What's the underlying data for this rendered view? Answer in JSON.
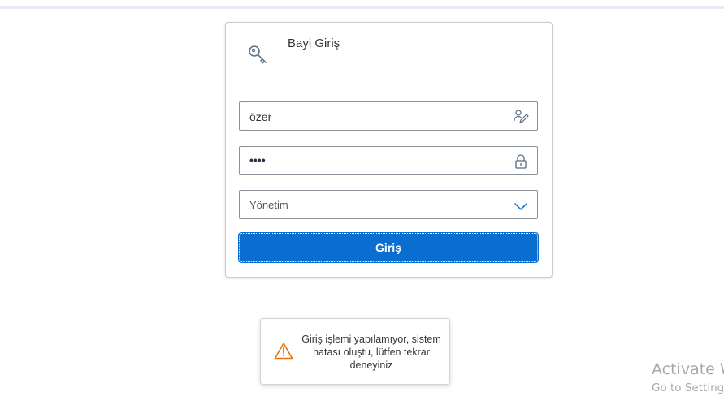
{
  "login": {
    "title": "Bayi Giriş",
    "username_value": "özer",
    "password_mask": "••••",
    "dealer_select_value": "Yönetim",
    "submit_label": "Giriş"
  },
  "toast": {
    "message": "Giriş işlemi yapılamıyor, sistem hatası oluştu, lütfen tekrar deneyiniz"
  },
  "watermark": {
    "line1": "Activate W",
    "line2": "Go to Setting"
  },
  "colors": {
    "accent": "#0a6ed1",
    "warning": "#e9730c"
  },
  "icons": {
    "header": "key-icon",
    "username": "user-edit-icon",
    "password": "lock-icon",
    "select": "chevron-down-icon",
    "toast": "warning-triangle-icon"
  }
}
